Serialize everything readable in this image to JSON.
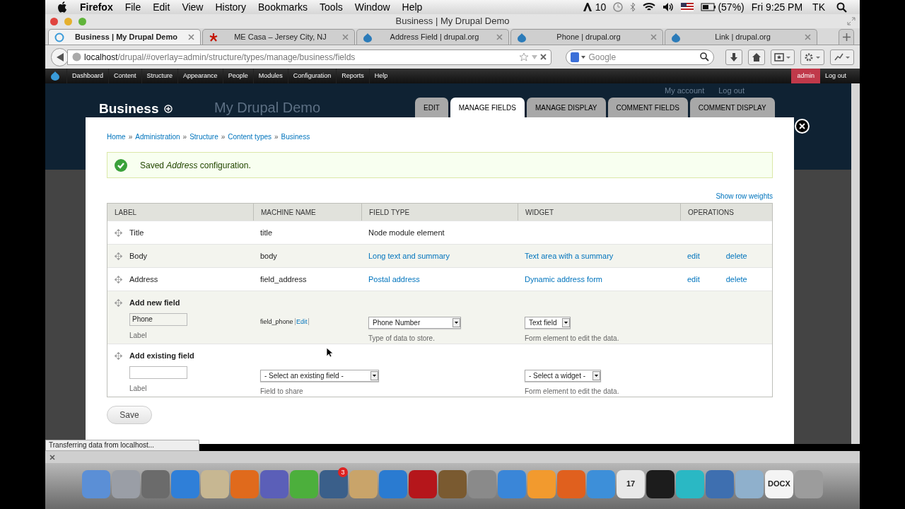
{
  "menu_bar": {
    "app": "Firefox",
    "items": [
      "File",
      "Edit",
      "View",
      "History",
      "Bookmarks",
      "Tools",
      "Window",
      "Help"
    ],
    "status": {
      "adobe_count": "10",
      "battery": "(57%)",
      "clock": "Fri 9:25 PM",
      "user": "TK"
    }
  },
  "window": {
    "title": "Business | My Drupal Demo"
  },
  "tabs": [
    {
      "label": "Business | My Drupal Demo",
      "selected": true,
      "kind": "loading"
    },
    {
      "label": "ME Casa – Jersey City, NJ",
      "selected": false,
      "kind": "yelp"
    },
    {
      "label": "Address Field | drupal.org",
      "selected": false,
      "kind": "drupal"
    },
    {
      "label": "Phone | drupal.org",
      "selected": false,
      "kind": "drupal"
    },
    {
      "label": "Link | drupal.org",
      "selected": false,
      "kind": "drupal"
    }
  ],
  "address_bar": {
    "host": "localhost",
    "path": "/drupal/#overlay=admin/structure/types/manage/business/fields"
  },
  "search": {
    "placeholder": "Google"
  },
  "admin_menu": {
    "items": [
      "Dashboard",
      "Content",
      "Structure",
      "Appearance",
      "People",
      "Modules",
      "Configuration",
      "Reports",
      "Help"
    ],
    "user": "admin",
    "logout": "Log out"
  },
  "site_header": {
    "site_name": "My Drupal Demo",
    "secondary_links": [
      "My account",
      "Log out"
    ]
  },
  "overlay": {
    "title": "Business",
    "tabs": [
      {
        "label": "EDIT",
        "selected": false
      },
      {
        "label": "MANAGE FIELDS",
        "selected": true
      },
      {
        "label": "MANAGE DISPLAY",
        "selected": false
      },
      {
        "label": "COMMENT FIELDS",
        "selected": false
      },
      {
        "label": "COMMENT DISPLAY",
        "selected": false
      }
    ],
    "breadcrumb": [
      "Home",
      "Administration",
      "Structure",
      "Content types",
      "Business"
    ],
    "breadcrumb_separator": "»",
    "message": "Saved *Address* configuration.",
    "row_weights_link": "Show row weights",
    "table": {
      "columns": [
        "LABEL",
        "MACHINE NAME",
        "FIELD TYPE",
        "WIDGET",
        "OPERATIONS"
      ],
      "rows": [
        {
          "kind": "field",
          "label": "Title",
          "machine_name": "title",
          "field_type": "Node module element",
          "field_type_link": false
        },
        {
          "kind": "field",
          "label": "Body",
          "machine_name": "body",
          "field_type": "Long text and summary",
          "field_type_link": true,
          "widget": "Text area with a summary",
          "operations": [
            "edit",
            "delete"
          ]
        },
        {
          "kind": "field",
          "label": "Address",
          "machine_name": "field_address",
          "field_type": "Postal address",
          "field_type_link": true,
          "widget": "Dynamic address form",
          "operations": [
            "edit",
            "delete"
          ]
        },
        {
          "kind": "new",
          "title": "Add new field",
          "label_value": "Phone",
          "label_hint": "Label",
          "machine_name": "field_phone",
          "machine_edit": "Edit",
          "type_select": "Phone Number",
          "type_hint": "Type of data to store.",
          "widget_select": "Text field",
          "widget_hint": "Form element to edit the data."
        },
        {
          "kind": "existing",
          "title": "Add existing field",
          "label_hint": "Label",
          "field_select": "- Select an existing field -",
          "field_hint": "Field to share",
          "widget_select": "- Select a widget -",
          "widget_hint": "Form element to edit the data."
        }
      ]
    },
    "save_button": "Save"
  },
  "status_bar": "Transferring data from localhost...",
  "dock": [
    {
      "color": "#5b8fd6"
    },
    {
      "color": "#9a9ea6"
    },
    {
      "color": "#6b6b6b"
    },
    {
      "color": "#2f7fd8"
    },
    {
      "color": "#c7b792"
    },
    {
      "color": "#e06a1c"
    },
    {
      "color": "#5b5fb8"
    },
    {
      "color": "#4caf3c"
    },
    {
      "color": "#3a5f8a",
      "badge": "3"
    },
    {
      "color": "#c9a46a"
    },
    {
      "color": "#2a7bd1"
    },
    {
      "color": "#b5161b"
    },
    {
      "color": "#7a5a30"
    },
    {
      "color": "#8a8a8a"
    },
    {
      "color": "#3a86d8"
    },
    {
      "color": "#f29a2e"
    },
    {
      "color": "#e0601e"
    },
    {
      "color": "#3d8fd9"
    },
    {
      "color": "#e8e8e8",
      "text": "17"
    },
    {
      "color": "#1c1c1c"
    },
    {
      "color": "#2ab8c4"
    },
    {
      "color": "#3e6fb0"
    },
    {
      "color": "#8fb0cc"
    },
    {
      "color": "#f4f4f4",
      "text": "DOCX"
    },
    {
      "color": "#9c9c9c"
    }
  ]
}
